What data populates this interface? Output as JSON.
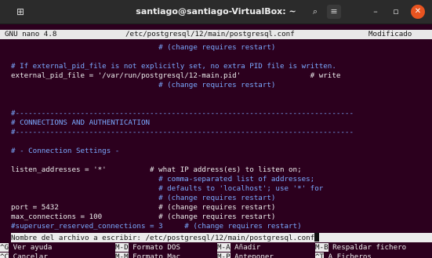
{
  "window": {
    "title": "santiago@santiago-VirtualBox: ~"
  },
  "editor": {
    "app": "GNU nano 4.8",
    "file": "/etc/postgresql/12/main/postgresql.conf",
    "status": "Modificado"
  },
  "lines": [
    {
      "text": "                                  # (change requires restart)",
      "kind": "comment"
    },
    {
      "text": "",
      "kind": "blank"
    },
    {
      "text": "# If external_pid_file is not explicitly set, no extra PID file is written.",
      "kind": "comment"
    },
    {
      "text": "external_pid_file = '/var/run/postgresql/12-main.pid'                # write",
      "kind": "code"
    },
    {
      "text": "                                  # (change requires restart)",
      "kind": "comment"
    },
    {
      "text": "",
      "kind": "blank"
    },
    {
      "text": "",
      "kind": "blank"
    },
    {
      "text": "#------------------------------------------------------------------------------",
      "kind": "comment"
    },
    {
      "text": "# CONNECTIONS AND AUTHENTICATION",
      "kind": "comment"
    },
    {
      "text": "#------------------------------------------------------------------------------",
      "kind": "comment"
    },
    {
      "text": "",
      "kind": "blank"
    },
    {
      "text": "# - Connection Settings -",
      "kind": "comment"
    },
    {
      "text": "",
      "kind": "blank"
    },
    {
      "text": "listen_addresses = '*'          # what IP address(es) to listen on;",
      "kind": "code"
    },
    {
      "text": "                                  # comma-separated list of addresses;",
      "kind": "comment"
    },
    {
      "text": "                                  # defaults to 'localhost'; use '*' for",
      "kind": "comment"
    },
    {
      "text": "                                  # (change requires restart)",
      "kind": "comment"
    },
    {
      "text": "port = 5432                       # (change requires restart)",
      "kind": "code"
    },
    {
      "text": "max_connections = 100             # (change requires restart)",
      "kind": "code"
    },
    {
      "text": "#superuser_reserved_connections = 3     # (change requires restart)",
      "kind": "comment"
    }
  ],
  "prompt": {
    "label": "Nombre del archivo a escribir: ",
    "value": "/etc/postgresql/12/main/postgresql.conf"
  },
  "shortcuts": [
    {
      "key": "^G",
      "label": "Ver ayuda"
    },
    {
      "key": "M-D",
      "label": "Formato DOS"
    },
    {
      "key": "M-A",
      "label": "Añadir"
    },
    {
      "key": "M-B",
      "label": "Respaldar fichero"
    },
    {
      "key": "^C",
      "label": "Cancelar"
    },
    {
      "key": "M-M",
      "label": "Formato Mac"
    },
    {
      "key": "M-P",
      "label": "Anteponer"
    },
    {
      "key": "^T",
      "label": "A Ficheros"
    }
  ],
  "colors": {
    "background": "#2c001e",
    "comment": "#7aa8ff",
    "text": "#ececec",
    "close_button": "#e95420"
  }
}
